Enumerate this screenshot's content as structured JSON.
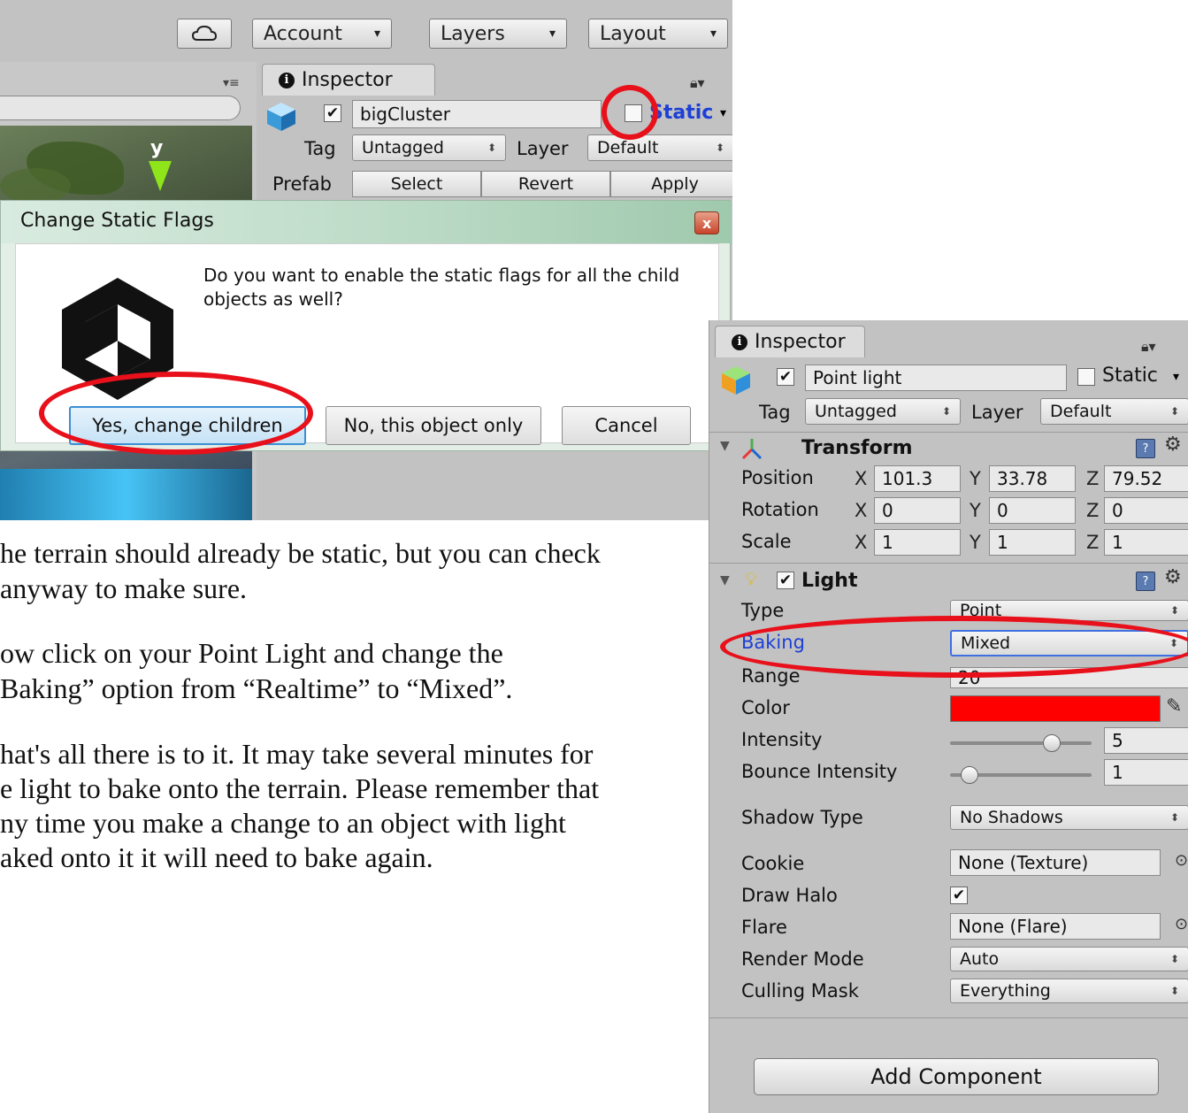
{
  "top": {
    "toolbar": {
      "cloud_icon": "cloud-icon",
      "account": "Account",
      "layers": "Layers",
      "layout": "Layout",
      "dropdown_arrow": "▾"
    },
    "inspector_tab": "Inspector",
    "object": {
      "name": "bigCluster",
      "static_label": "Static",
      "tag_label": "Tag",
      "tag_value": "Untagged",
      "layer_label": "Layer",
      "layer_value": "Default",
      "prefab_label": "Prefab",
      "prefab_select": "Select",
      "prefab_revert": "Revert",
      "prefab_apply": "Apply"
    },
    "scene_axis_label": "y",
    "dialog": {
      "title": "Change Static Flags",
      "close": "x",
      "message": "Do you want to enable the static flags for all the child objects as well?",
      "btn_yes": "Yes, change children",
      "btn_no": "No, this object only",
      "btn_cancel": "Cancel"
    }
  },
  "paragraphs": [
    "he terrain should already be static, but you can check",
    "anyway to make sure.",
    "ow click on your Point Light and change the",
    "Baking” option from “Realtime” to “Mixed”.",
    "hat's all there is to it. It may take several minutes for",
    "e light to bake onto the terrain. Please remember that",
    "ny time you make a change to an object with light",
    "aked onto it it will need to bake again."
  ],
  "inspector": {
    "tab": "Inspector",
    "object_name": "Point light",
    "static_label": "Static",
    "tag_label": "Tag",
    "tag_value": "Untagged",
    "layer_label": "Layer",
    "layer_value": "Default",
    "transform": {
      "title": "Transform",
      "position_label": "Position",
      "rotation_label": "Rotation",
      "scale_label": "Scale",
      "x": "X",
      "y": "Y",
      "z": "Z",
      "position": [
        "101.3",
        "33.78",
        "79.52"
      ],
      "rotation": [
        "0",
        "0",
        "0"
      ],
      "scale": [
        "1",
        "1",
        "1"
      ]
    },
    "light": {
      "title": "Light",
      "type_label": "Type",
      "type_value": "Point",
      "baking_label": "Baking",
      "baking_value": "Mixed",
      "range_label": "Range",
      "range_value": "20",
      "color_label": "Color",
      "color_value": "#ff0000",
      "intensity_label": "Intensity",
      "intensity_value": "5",
      "intensity_level": 0.72,
      "bounce_label": "Bounce Intensity",
      "bounce_value": "1",
      "bounce_level": 0.14,
      "shadow_label": "Shadow Type",
      "shadow_value": "No Shadows",
      "cookie_label": "Cookie",
      "cookie_value": "None (Texture)",
      "halo_label": "Draw Halo",
      "flare_label": "Flare",
      "flare_value": "None (Flare)",
      "render_label": "Render Mode",
      "render_value": "Auto",
      "culling_label": "Culling Mask",
      "culling_value": "Everything"
    },
    "add_component": "Add Component"
  },
  "colors": {
    "annotation_red": "#e8101a",
    "static_blue": "#1d3fd6"
  }
}
